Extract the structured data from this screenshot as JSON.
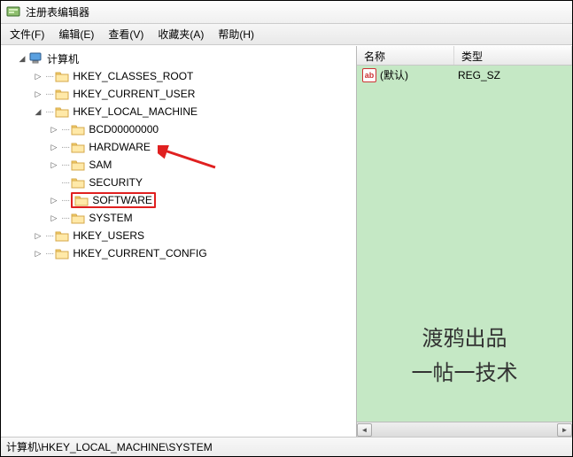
{
  "window": {
    "title": "注册表编辑器"
  },
  "menu": {
    "file": "文件(F)",
    "edit": "编辑(E)",
    "view": "查看(V)",
    "favorites": "收藏夹(A)",
    "help": "帮助(H)"
  },
  "tree": {
    "root": "计算机",
    "hkcr": "HKEY_CLASSES_ROOT",
    "hkcu": "HKEY_CURRENT_USER",
    "hklm": "HKEY_LOCAL_MACHINE",
    "hklm_children": {
      "bcd": "BCD00000000",
      "hardware": "HARDWARE",
      "sam": "SAM",
      "security": "SECURITY",
      "software": "SOFTWARE",
      "system": "SYSTEM"
    },
    "hku": "HKEY_USERS",
    "hkcc": "HKEY_CURRENT_CONFIG"
  },
  "list": {
    "columns": {
      "name": "名称",
      "type": "类型"
    },
    "rows": [
      {
        "name": "(默认)",
        "type": "REG_SZ"
      }
    ]
  },
  "watermark": {
    "line1": "渡鸦出品",
    "line2": "一帖一技术"
  },
  "status": {
    "path": "计算机\\HKEY_LOCAL_MACHINE\\SYSTEM"
  },
  "glyphs": {
    "triangle_collapsed": "▷",
    "triangle_expanded": "◢",
    "dots": "····"
  }
}
